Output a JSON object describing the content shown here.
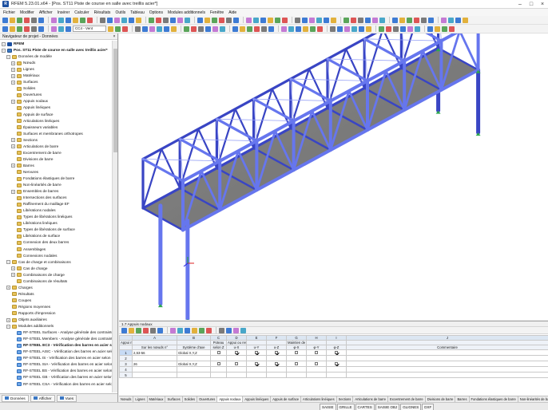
{
  "window": {
    "title": "RFEM 5.23.01.x64 - [Pos. ST11 Piste de course en salle avec treillis acier*]",
    "app_icon_label": "R"
  },
  "menu": [
    "Fichier",
    "Modifier",
    "Afficher",
    "Insérer",
    "Calculer",
    "Résultats",
    "Outils",
    "Tableau",
    "Options",
    "Modules additionnels",
    "Fenêtre",
    "Aide"
  ],
  "toolbar": {
    "load_case_combo": "CC4 - Vent",
    "small_combo": ""
  },
  "navigator": {
    "title": "Navigateur de projet - Données",
    "items": [
      {
        "level": 0,
        "exp": "-",
        "icon": "root",
        "label": "RFEM",
        "bold": true
      },
      {
        "level": 0,
        "exp": "-",
        "icon": "mod",
        "label": "Pos. ST11 Piste de course en salle avec treillis acier*",
        "bold": true
      },
      {
        "level": 1,
        "exp": "-",
        "icon": "folder",
        "label": "Données de modèle"
      },
      {
        "level": 2,
        "exp": "+",
        "icon": "folder",
        "label": "Nœuds"
      },
      {
        "level": 2,
        "exp": "+",
        "icon": "folder",
        "label": "Lignes"
      },
      {
        "level": 2,
        "exp": "+",
        "icon": "folder",
        "label": "Matériaux"
      },
      {
        "level": 2,
        "exp": "+",
        "icon": "folder",
        "label": "Surfaces"
      },
      {
        "level": 2,
        "exp": "",
        "icon": "folder",
        "label": "Solides"
      },
      {
        "level": 2,
        "exp": "",
        "icon": "folder",
        "label": "Ouvertures"
      },
      {
        "level": 2,
        "exp": "+",
        "icon": "folder",
        "label": "Appuis nodaux"
      },
      {
        "level": 2,
        "exp": "",
        "icon": "folder",
        "label": "Appuis linéiques"
      },
      {
        "level": 2,
        "exp": "",
        "icon": "folder",
        "label": "Appuis de surface"
      },
      {
        "level": 2,
        "exp": "",
        "icon": "folder",
        "label": "Articulations linéiques"
      },
      {
        "level": 2,
        "exp": "",
        "icon": "folder",
        "label": "Épaisseurs variables"
      },
      {
        "level": 2,
        "exp": "",
        "icon": "folder",
        "label": "Surfaces et membranes orthotropes"
      },
      {
        "level": 2,
        "exp": "+",
        "icon": "folder",
        "label": "Sections"
      },
      {
        "level": 2,
        "exp": "+",
        "icon": "folder",
        "label": "Articulations de barre"
      },
      {
        "level": 2,
        "exp": "",
        "icon": "folder",
        "label": "Excentrement de barre"
      },
      {
        "level": 2,
        "exp": "",
        "icon": "folder",
        "label": "Divisions de barre"
      },
      {
        "level": 2,
        "exp": "+",
        "icon": "folder",
        "label": "Barres"
      },
      {
        "level": 2,
        "exp": "",
        "icon": "folder",
        "label": "Nervures"
      },
      {
        "level": 2,
        "exp": "",
        "icon": "folder",
        "label": "Fondations élastiques de barre"
      },
      {
        "level": 2,
        "exp": "",
        "icon": "folder",
        "label": "Non-linéarités de barre"
      },
      {
        "level": 2,
        "exp": "+",
        "icon": "folder",
        "label": "Ensembles de barres"
      },
      {
        "level": 2,
        "exp": "",
        "icon": "folder",
        "label": "Intersections des surfaces"
      },
      {
        "level": 2,
        "exp": "",
        "icon": "folder",
        "label": "Raffinement du maillage EF"
      },
      {
        "level": 2,
        "exp": "",
        "icon": "folder",
        "label": "Libérations nodales"
      },
      {
        "level": 2,
        "exp": "",
        "icon": "folder",
        "label": "Types de libérations linéiques"
      },
      {
        "level": 2,
        "exp": "",
        "icon": "folder",
        "label": "Libérations linéiques"
      },
      {
        "level": 2,
        "exp": "",
        "icon": "folder",
        "label": "Types de libérations de surface"
      },
      {
        "level": 2,
        "exp": "",
        "icon": "folder",
        "label": "Libérations de surface"
      },
      {
        "level": 2,
        "exp": "",
        "icon": "folder",
        "label": "Connexion des deux barres"
      },
      {
        "level": 2,
        "exp": "",
        "icon": "folder",
        "label": "Assemblages"
      },
      {
        "level": 2,
        "exp": "",
        "icon": "folder",
        "label": "Connexions nodales"
      },
      {
        "level": 1,
        "exp": "-",
        "icon": "folder",
        "label": "Cas de charge et combinaisons"
      },
      {
        "level": 2,
        "exp": "+",
        "icon": "folder",
        "label": "Cas de charge"
      },
      {
        "level": 2,
        "exp": "+",
        "icon": "folder",
        "label": "Combinaisons de charge"
      },
      {
        "level": 2,
        "exp": "",
        "icon": "folder",
        "label": "Combinaisons de résultats"
      },
      {
        "level": 1,
        "exp": "+",
        "icon": "folder",
        "label": "Charges"
      },
      {
        "level": 1,
        "exp": "",
        "icon": "folder",
        "label": "Résultats"
      },
      {
        "level": 1,
        "exp": "",
        "icon": "folder",
        "label": "Coupes"
      },
      {
        "level": 1,
        "exp": "",
        "icon": "folder",
        "label": "Régions moyennes"
      },
      {
        "level": 1,
        "exp": "",
        "icon": "folder",
        "label": "Rapports d'impression"
      },
      {
        "level": 1,
        "exp": "+",
        "icon": "folder",
        "label": "Objets auxiliaires"
      },
      {
        "level": 1,
        "exp": "-",
        "icon": "folder",
        "label": "Modules additionnels"
      },
      {
        "level": 2,
        "exp": "",
        "icon": "blue",
        "label": "RF-STEEL Surfaces - Analyse générale des contraintes de s"
      },
      {
        "level": 2,
        "exp": "",
        "icon": "blue",
        "label": "RF-STEEL Members - Analyse générale des contraintes de bar"
      },
      {
        "level": 2,
        "exp": "",
        "icon": "blue",
        "label": "RF-STEEL EC3 - Vérification des barres en acier selon l'Eu",
        "bold": true
      },
      {
        "level": 2,
        "exp": "",
        "icon": "blue",
        "label": "RF-STEEL AISC - Vérification des barres en acier selon AISC ("
      },
      {
        "level": 2,
        "exp": "",
        "icon": "blue",
        "label": "RF-STEEL IS - Vérification des barres en acier selon IS"
      },
      {
        "level": 2,
        "exp": "",
        "icon": "blue",
        "label": "RF-STEEL SIA - Vérification des barres en acier selon SIA"
      },
      {
        "level": 2,
        "exp": "",
        "icon": "blue",
        "label": "RF-STEEL BS - Vérification des barres en acier selon BS"
      },
      {
        "level": 2,
        "exp": "",
        "icon": "blue",
        "label": "RF-STEEL GB - Vérification des barres en acier selon GB"
      },
      {
        "level": 2,
        "exp": "",
        "icon": "blue",
        "label": "RF-STEEL CSA - Vérification des barres en acier selon CSA"
      }
    ],
    "tabs": [
      {
        "label": "Données",
        "active": true
      },
      {
        "label": "Afficher",
        "active": false
      },
      {
        "label": "Vues",
        "active": false
      }
    ]
  },
  "table": {
    "title": "1.7 Appuis nodaux",
    "letters": [
      "A",
      "B",
      "C",
      "D",
      "E",
      "F",
      "G",
      "H",
      "I",
      "J"
    ],
    "head1": [
      "Appui n°",
      "",
      "",
      "Poteau",
      "Appui ou ressort [kN/m]",
      "",
      "",
      "Maintien de rotation ou ressort [kNm/rad]",
      "",
      "",
      ""
    ],
    "head2": [
      "",
      "Sur les nœuds n°",
      "Système d'axe",
      "selon Z",
      "u-X",
      "u-Y",
      "u-Z",
      "φ-X",
      "φ-Y",
      "φ-Z",
      "Commentaire"
    ],
    "rows": [
      {
        "no": "1",
        "nodes": "2,53-56",
        "axis": "Global X,Y,Z",
        "col": false,
        "ux": true,
        "uy": true,
        "uz": true,
        "px": false,
        "py": false,
        "pz": true,
        "selected": true
      },
      {
        "no": "2",
        "nodes": "",
        "axis": "",
        "empty": true
      },
      {
        "no": "3",
        "nodes": "26",
        "axis": "Global X,Y,Z",
        "col": false,
        "ux": false,
        "uy": true,
        "uz": true,
        "px": false,
        "py": false,
        "pz": true
      },
      {
        "no": "4",
        "nodes": "",
        "axis": "",
        "empty": true
      },
      {
        "no": "5",
        "nodes": "",
        "axis": "",
        "empty": true
      }
    ],
    "tabs": [
      "Nœuds",
      "Lignes",
      "Matériaux",
      "Surfaces",
      "Solides",
      "Ouvertures",
      "Appuis nodaux",
      "Appuis linéiques",
      "Appuis de surface",
      "Articulations linéiques",
      "Sections",
      "Articulations de barre",
      "Excentrement de barre",
      "Divisions de barre",
      "Barres",
      "Fondations élastiques de barre",
      "Non-linéarités de barre"
    ],
    "active_tab": "Appuis nodaux"
  },
  "status": [
    "SAISIE",
    "GRILLE",
    "CARTES",
    "SAISIE OBJ",
    "GLIGNES",
    "DXF"
  ],
  "colors": {
    "beam": "#6676ee",
    "beam_dark": "#3945c4",
    "deck": "#808080",
    "support": "#2fa84f",
    "accent": "#1b4fa0"
  }
}
